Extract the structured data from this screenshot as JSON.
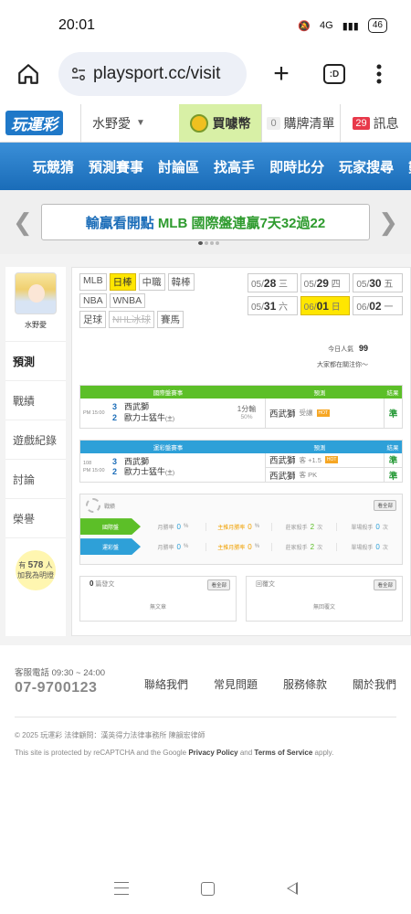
{
  "status": {
    "time": "20:01",
    "battery": "46",
    "network": "4G"
  },
  "browser": {
    "url": "playsport.cc/visit",
    "tab_count": ":D"
  },
  "site": {
    "logo": "玩運彩",
    "user": "水野愛",
    "coin_label": "買噱幣",
    "cart_label": "購牌清單",
    "cart_count": "0",
    "msg_label": "訊息",
    "msg_count": "29"
  },
  "nav": [
    "玩競猜",
    "預測賽事",
    "討論區",
    "找高手",
    "即時比分",
    "玩家搜尋",
    "數據"
  ],
  "ticker": {
    "prefix": "輸贏看開點",
    "highlight": "MLB 國際盤連贏7天32過22"
  },
  "sidebar": {
    "name": "水野愛",
    "items": [
      "預測",
      "戰績",
      "遊戲紀錄",
      "討論",
      "榮譽"
    ],
    "fans_prefix": "有",
    "fans_count": "578",
    "fans_suffix": "人",
    "fans_note": "加我為明燈"
  },
  "leagues": [
    [
      "MLB",
      "日棒",
      "中職",
      "韓棒"
    ],
    [
      "NBA",
      "WNBA"
    ],
    [
      "足球",
      "NHL冰球",
      "賽馬"
    ]
  ],
  "dates": [
    [
      {
        "d": "05/",
        "b": "28",
        "w": "三"
      },
      {
        "d": "05/",
        "b": "29",
        "w": "四"
      },
      {
        "d": "05/",
        "b": "30",
        "w": "五"
      }
    ],
    [
      {
        "d": "05/",
        "b": "31",
        "w": "六"
      },
      {
        "d": "06/",
        "b": "01",
        "w": "日"
      },
      {
        "d": "06/",
        "b": "02",
        "w": "一"
      }
    ]
  ],
  "popularity": {
    "label": "今日人氣",
    "count": "99",
    "note": "大家都在關注你～"
  },
  "table1": {
    "h1": "國際盤賽事",
    "h2": "預測",
    "h3": "結果",
    "time": "PM 15:00",
    "team1_num": "3",
    "team1": "西武獅",
    "team2_num": "2",
    "team2": "歐力士猛牛",
    "team2_tag": "(主)",
    "line": "1分輸",
    "line_pct": "50%",
    "pred_team": "西武獅",
    "pred_sub": "受讓",
    "hot": "HOT",
    "result": "準"
  },
  "table2": {
    "h1": "運彩盤賽事",
    "h2": "預測",
    "h3": "結果",
    "game_no": "108",
    "time": "PM 15:00",
    "team1_num": "3",
    "team1": "西武獅",
    "team2_num": "2",
    "team2": "歐力士猛牛",
    "team2_tag": "(主)",
    "pred1_team": "西武獅",
    "pred1_sub": "客 +1.5",
    "hot": "HOT",
    "pred2_team": "西武獅",
    "pred2_sub": "客 PK",
    "result1": "準",
    "result2": "準"
  },
  "record": {
    "title": "戰績",
    "more": "看全部",
    "rows": [
      {
        "tag": "國際盤",
        "c1": "月勝率",
        "v1": "0",
        "c2": "主推月勝率",
        "v2": "0",
        "c3": "莊家殺手",
        "v3": "2",
        "u3": "次",
        "c4": "單場殺手",
        "v4": "0",
        "u4": "次"
      },
      {
        "tag": "運彩盤",
        "c1": "月勝率",
        "v1": "0",
        "c2": "主推月勝率",
        "v2": "0",
        "c3": "莊家殺手",
        "v3": "2",
        "u3": "次",
        "c4": "單場殺手",
        "v4": "0",
        "u4": "次"
      }
    ]
  },
  "posts": {
    "left_count": "0",
    "left_title": "篇發文",
    "left_more": "看全部",
    "left_empty": "無文章",
    "right_title": "回覆文",
    "right_more": "看全部",
    "right_empty": "無回覆文"
  },
  "footer": {
    "hotline_label": "客服電話 09:30 ~ 24:00",
    "phone": "07-9700123",
    "links": [
      "聯絡我們",
      "常見問題",
      "服務條款",
      "關於我們"
    ],
    "copyright": "© 2025 玩運彩 法律顧問：漢英得力法律事務所 陳韻宏律師",
    "recaptcha_pre": "This site is protected by reCAPTCHA and the Google",
    "privacy": "Privacy Policy",
    "and": "and",
    "terms": "Terms of Service",
    "apply": "apply."
  }
}
